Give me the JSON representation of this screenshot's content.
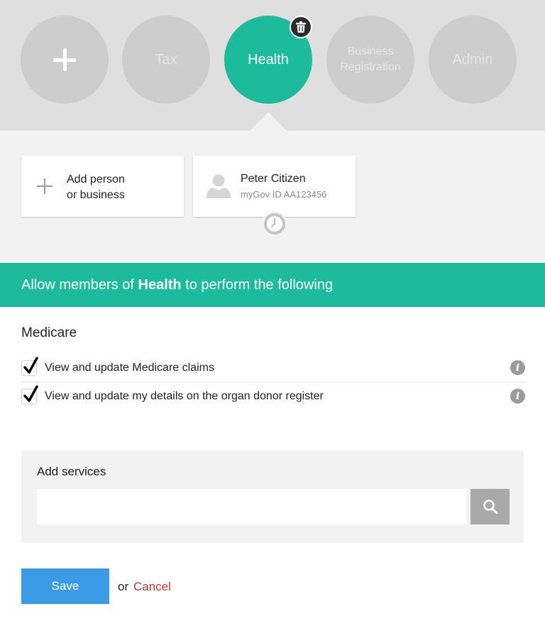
{
  "groups": {
    "add_label": "+",
    "items": [
      {
        "label": "Tax",
        "active": false
      },
      {
        "label": "Health",
        "active": true
      },
      {
        "label": "Business Registration",
        "active": false
      },
      {
        "label": "Admin",
        "active": false
      }
    ]
  },
  "members": {
    "add_card": {
      "line1": "Add person",
      "line2": "or business"
    },
    "person": {
      "name": "Peter Citizen",
      "id": "myGov ID AA123456"
    }
  },
  "banner": {
    "prefix": "Allow members of ",
    "group": "Health",
    "suffix": " to perform the following"
  },
  "permissions": {
    "section_title": "Medicare",
    "items": [
      {
        "label": "View and update Medicare claims",
        "checked": true
      },
      {
        "label": "View and update my details on the organ donor register",
        "checked": true
      }
    ]
  },
  "services": {
    "title": "Add services",
    "input_value": "",
    "placeholder": ""
  },
  "actions": {
    "save_label": "Save",
    "or_label": "or",
    "cancel_label": "Cancel"
  },
  "colors": {
    "accent": "#1cbb9b",
    "primary_button": "#3b9be6",
    "cancel_link": "#c0392b"
  }
}
